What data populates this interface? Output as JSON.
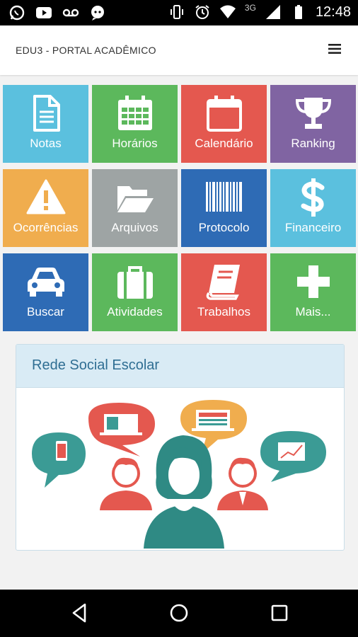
{
  "status_bar": {
    "time": "12:48",
    "network": "3G",
    "left_icons": [
      "whatsapp-icon",
      "youtube-icon",
      "voicemail-icon",
      "chat-icon"
    ],
    "right_icons": [
      "vibrate-icon",
      "alarm-icon",
      "wifi-icon",
      "signal-icon",
      "battery-icon"
    ]
  },
  "app_bar": {
    "title": "EDU3 - PORTAL ACADÊMICO",
    "menu_icon": "hamburger-menu-icon"
  },
  "tiles": [
    {
      "label": "Notas",
      "icon": "document-icon",
      "color": "#5bc0de"
    },
    {
      "label": "Horários",
      "icon": "calendar-grid-icon",
      "color": "#5cb85c"
    },
    {
      "label": "Calendário",
      "icon": "calendar-icon",
      "color": "#e4584f"
    },
    {
      "label": "Ranking",
      "icon": "trophy-icon",
      "color": "#8064a2"
    },
    {
      "label": "Ocorrências",
      "icon": "warning-icon",
      "color": "#f0ad4e"
    },
    {
      "label": "Arquivos",
      "icon": "folder-open-icon",
      "color": "#9ea4a4"
    },
    {
      "label": "Protocolo",
      "icon": "barcode-icon",
      "color": "#2e6bb5"
    },
    {
      "label": "Financeiro",
      "icon": "dollar-icon",
      "color": "#5bc0de"
    },
    {
      "label": "Buscar",
      "icon": "car-icon",
      "color": "#2e6bb5"
    },
    {
      "label": "Atividades",
      "icon": "briefcase-icon",
      "color": "#5cb85c"
    },
    {
      "label": "Trabalhos",
      "icon": "book-icon",
      "color": "#e4584f"
    },
    {
      "label": "Mais...",
      "icon": "plus-icon",
      "color": "#5cb85c"
    }
  ],
  "social_panel": {
    "title": "Rede Social Escolar",
    "image": "social-network-illustration"
  },
  "nav_bar": {
    "buttons": [
      "back-button",
      "home-button",
      "recents-button"
    ]
  }
}
